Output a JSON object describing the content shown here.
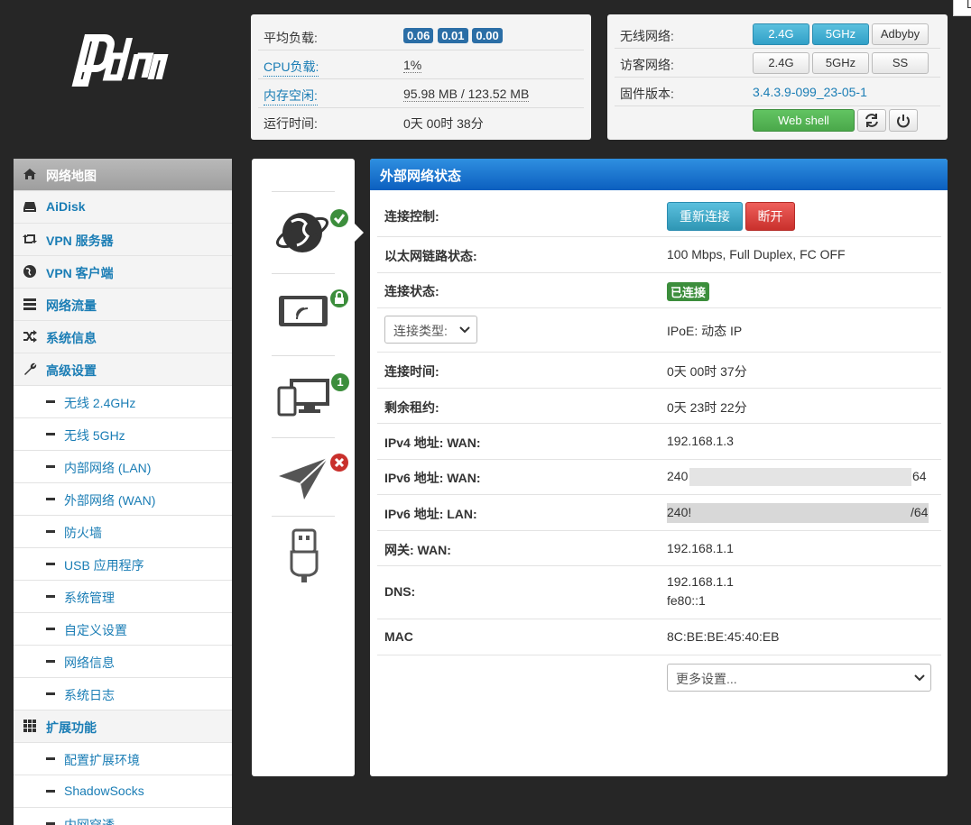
{
  "logo_text": "pdcn",
  "status": {
    "load_label": "平均负载:",
    "load_values": [
      "0.06",
      "0.01",
      "0.00"
    ],
    "cpu_label": "CPU负载:",
    "cpu_value": "1%",
    "mem_label": "内存空闲:",
    "mem_value": "95.98 MB / 123.52 MB",
    "uptime_label": "运行时间:",
    "uptime_value": "0天 00时 38分"
  },
  "wireless": {
    "wifi_label": "无线网络:",
    "wifi_buttons": [
      "2.4G",
      "5GHz",
      "Adbyby"
    ],
    "guest_label": "访客网络:",
    "guest_buttons": [
      "2.4G",
      "5GHz",
      "SS"
    ],
    "fw_label": "固件版本:",
    "fw_value": "3.4.3.9-099_23-05-1",
    "webshell_label": "Web shell"
  },
  "sidebar": {
    "items": [
      {
        "label": "网络地图",
        "icon": "home-icon"
      },
      {
        "label": "AiDisk",
        "icon": "hdd-icon"
      },
      {
        "label": "VPN 服务器",
        "icon": "retweet-icon"
      },
      {
        "label": "VPN 客户端",
        "icon": "globe-icon"
      },
      {
        "label": "网络流量",
        "icon": "list-icon"
      },
      {
        "label": "系统信息",
        "icon": "random-icon"
      },
      {
        "label": "高级设置",
        "icon": "wrench-icon"
      },
      {
        "label": "无线 2.4GHz"
      },
      {
        "label": "无线 5GHz"
      },
      {
        "label": "内部网络 (LAN)"
      },
      {
        "label": "外部网络 (WAN)"
      },
      {
        "label": "防火墙"
      },
      {
        "label": "USB 应用程序"
      },
      {
        "label": "系统管理"
      },
      {
        "label": "自定义设置"
      },
      {
        "label": "网络信息"
      },
      {
        "label": "系统日志"
      },
      {
        "label": "扩展功能",
        "icon": "grid-icon"
      },
      {
        "label": "配置扩展环境"
      },
      {
        "label": "ShadowSocks"
      },
      {
        "label": "内网穿透"
      }
    ]
  },
  "iconcol": {
    "clients_count": "1"
  },
  "wan": {
    "title": "外部网络状态",
    "control_label": "连接控制:",
    "reconnect_label": "重新连接",
    "disconnect_label": "断开",
    "link_label": "以太网链路状态:",
    "link_value": "100 Mbps, Full Duplex, FC OFF",
    "conn_label": "连接状态:",
    "conn_value": "已连接",
    "type_select": "连接类型:",
    "type_value": "IPoE: 动态 IP",
    "time_label": "连接时间:",
    "time_value": "0天 00时 37分",
    "lease_label": "剩余租约:",
    "lease_value": "0天 23时 22分",
    "ipv4_label": "IPv4 地址: WAN:",
    "ipv4_value": "192.168.1.3",
    "ipv6wan_label": "IPv6 地址: WAN:",
    "ipv6wan_start": "240",
    "ipv6wan_end": "64",
    "ipv6lan_label": "IPv6 地址: LAN:",
    "ipv6lan_start": "240!",
    "ipv6lan_end": "/64",
    "gw_label": "网关: WAN:",
    "gw_value": "192.168.1.1",
    "dns_label": "DNS:",
    "dns_value1": "192.168.1.1",
    "dns_value2": "fe80::1",
    "mac_label": "MAC",
    "mac_value": "8C:BE:BE:45:40:EB",
    "more_select": "更多设置..."
  },
  "corner_text": "L"
}
